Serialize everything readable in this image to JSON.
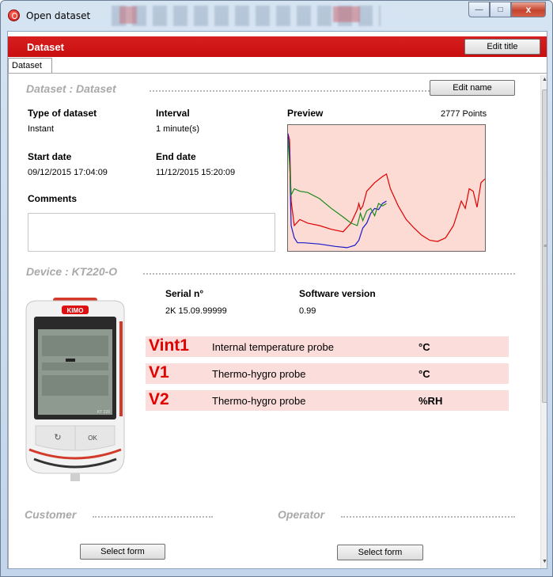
{
  "window": {
    "title": "Open dataset",
    "controls": {
      "minimize": "—",
      "maximize": "□",
      "close": "x"
    }
  },
  "header": {
    "title": "Dataset",
    "edit_title_button": "Edit title"
  },
  "tabs": [
    {
      "label": "Dataset"
    }
  ],
  "dataset": {
    "section_title": "Dataset : Dataset",
    "edit_name_button": "Edit name",
    "type_label": "Type of dataset",
    "type_value": "Instant",
    "interval_label": "Interval",
    "interval_value": "1 minute(s)",
    "start_label": "Start date",
    "start_value": "09/12/2015 17:04:09",
    "end_label": "End date",
    "end_value": "11/12/2015 15:20:09",
    "comments_label": "Comments",
    "comments_value": "",
    "preview_label": "Preview",
    "points_label": "2777 Points"
  },
  "chart_data": {
    "type": "line",
    "title": "",
    "background": "#fbdbd3",
    "series": [
      {
        "color": "#e00000",
        "x": [
          0,
          2,
          4,
          8,
          15,
          25,
          40,
          55,
          70,
          80,
          88,
          90,
          92,
          95,
          100,
          110,
          120,
          125,
          130,
          140,
          150,
          160,
          170,
          180,
          190,
          200,
          210,
          220,
          225,
          230,
          235,
          240,
          245,
          250
        ],
        "y": [
          0.95,
          0.9,
          0.4,
          0.2,
          0.25,
          0.22,
          0.2,
          0.17,
          0.15,
          0.22,
          0.33,
          0.38,
          0.33,
          0.36,
          0.48,
          0.55,
          0.6,
          0.62,
          0.5,
          0.36,
          0.25,
          0.18,
          0.12,
          0.08,
          0.07,
          0.1,
          0.2,
          0.4,
          0.34,
          0.5,
          0.48,
          0.35,
          0.55,
          0.58
        ]
      },
      {
        "color": "#1a1acc",
        "x": [
          0,
          2,
          4,
          8,
          12,
          20,
          40,
          60,
          75,
          85,
          90,
          95,
          100,
          105,
          110,
          115,
          120,
          125
        ],
        "y": [
          0.95,
          0.8,
          0.2,
          0.1,
          0.06,
          0.06,
          0.05,
          0.03,
          0.02,
          0.04,
          0.08,
          0.18,
          0.22,
          0.3,
          0.34,
          0.33,
          0.38,
          0.4
        ]
      },
      {
        "color": "#1a8a1a",
        "x": [
          0,
          2,
          4,
          8,
          15,
          25,
          40,
          55,
          70,
          80,
          88,
          92,
          95,
          100,
          105,
          110,
          115,
          120,
          125
        ],
        "y": [
          0.9,
          0.7,
          0.45,
          0.5,
          0.48,
          0.47,
          0.42,
          0.34,
          0.27,
          0.22,
          0.2,
          0.3,
          0.24,
          0.32,
          0.34,
          0.28,
          0.38,
          0.36,
          0.38
        ]
      }
    ]
  },
  "device": {
    "section_title": "Device : KT220-O",
    "serial_label": "Serial n°",
    "serial_value": "2K 15.09.99999",
    "software_label": "Software version",
    "software_value": "0.99",
    "brand": "KIMO",
    "model": "KT 220",
    "ok_label": "OK",
    "probes": [
      {
        "code": "Vint1",
        "name": "Internal temperature probe",
        "unit": "°C"
      },
      {
        "code": "V1",
        "name": "Thermo-hygro probe",
        "unit": "°C"
      },
      {
        "code": "V2",
        "name": "Thermo-hygro probe",
        "unit": "%RH"
      }
    ]
  },
  "customer": {
    "section_title": "Customer",
    "button": "Select form"
  },
  "operator": {
    "section_title": "Operator",
    "button": "Select form"
  },
  "colors": {
    "accent_red": "#c80e0e",
    "probe_text": "#e10000",
    "probe_bg": "#fbdedb"
  }
}
